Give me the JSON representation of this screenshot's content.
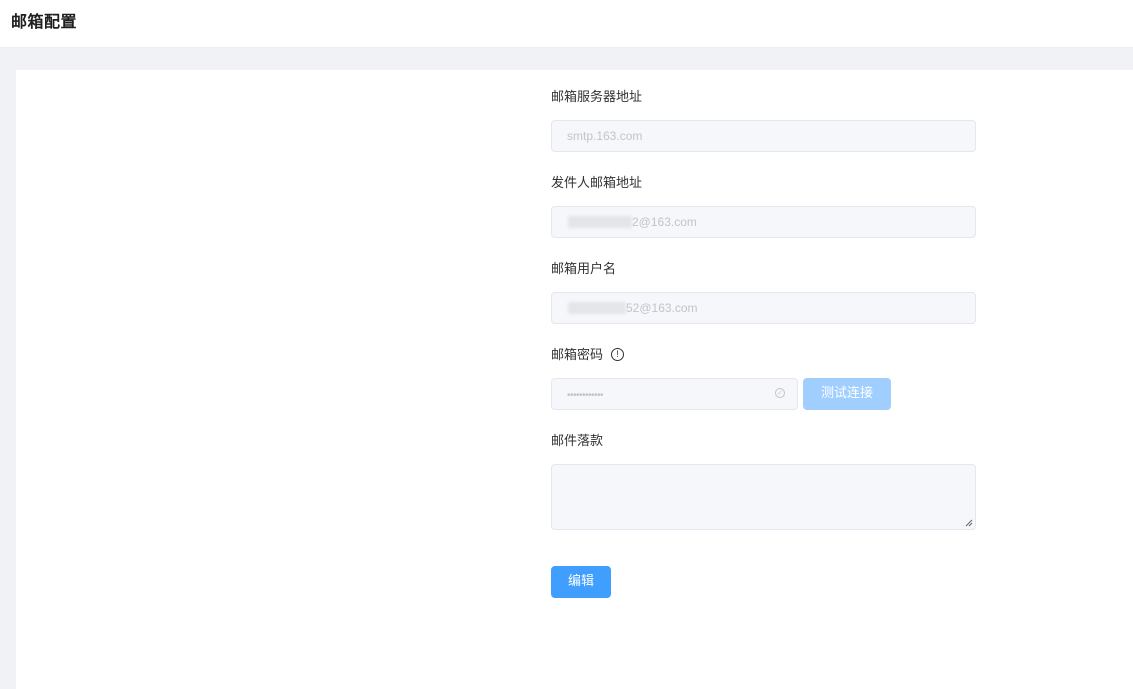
{
  "header": {
    "title": "邮箱配置"
  },
  "form": {
    "smtp_server": {
      "label": "邮箱服务器地址",
      "value": "smtp.163.com"
    },
    "sender_address": {
      "label": "发件人邮箱地址",
      "value": "2@163.com"
    },
    "username": {
      "label": "邮箱用户名",
      "value": "52@163.com"
    },
    "password": {
      "label": "邮箱密码",
      "value": "••••••••••••",
      "info_icon": "info-circle-icon",
      "status_icon": "circle-check-icon"
    },
    "test_connection_button": "测试连接",
    "signature": {
      "label": "邮件落款",
      "value": ""
    },
    "edit_button": "编辑"
  },
  "colors": {
    "primary": "#409eff",
    "primary_disabled": "#a0cfff",
    "input_bg": "#f5f7fa",
    "page_bg": "#f0f2f5"
  }
}
